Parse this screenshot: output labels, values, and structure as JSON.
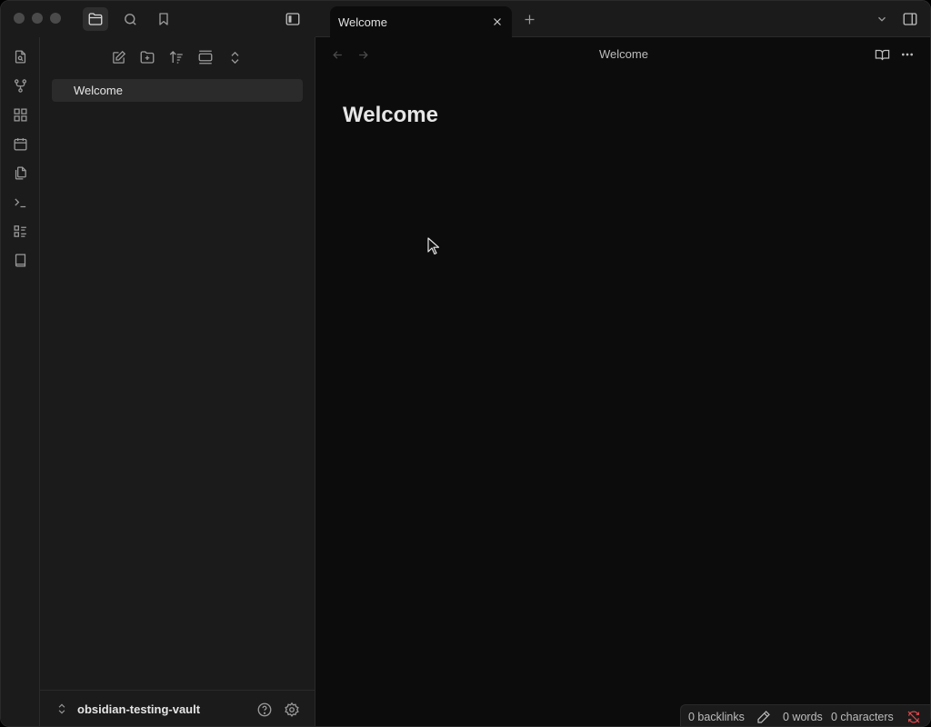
{
  "sidebar": {
    "files": [
      {
        "label": "Welcome"
      }
    ],
    "vault": {
      "name": "obsidian-testing-vault"
    }
  },
  "tabs": [
    {
      "title": "Welcome"
    }
  ],
  "view": {
    "title": "Welcome"
  },
  "note": {
    "heading": "Welcome"
  },
  "statusbar": {
    "backlinks": "0 backlinks",
    "words": "0 words",
    "characters": "0 characters"
  },
  "colors": {
    "background": "#0c0c0c",
    "panel": "#1b1b1b",
    "text": "#dadada",
    "muted_icon": "#9a9a9a",
    "sync_error": "#e5484d"
  }
}
